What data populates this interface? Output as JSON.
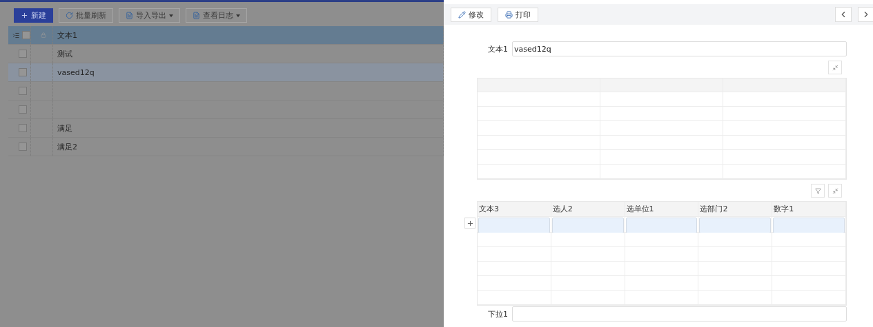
{
  "toolbar": {
    "buttons": [
      {
        "label": "新建",
        "kind": "primary",
        "dropdown": false
      },
      {
        "label": "批量刷新",
        "kind": "default",
        "dropdown": false
      },
      {
        "label": "导入导出",
        "kind": "default",
        "dropdown": true
      },
      {
        "label": "查看日志",
        "kind": "default",
        "dropdown": true
      }
    ]
  },
  "list": {
    "header": "文本1",
    "header_checked": false,
    "rows": [
      {
        "text": "测试",
        "selected": false,
        "checked": false
      },
      {
        "text": "vased12q",
        "selected": true,
        "checked": false
      },
      {
        "selected": false,
        "checked": false
      },
      {
        "selected": false,
        "checked": false
      },
      {
        "text": "满足",
        "selected": false,
        "checked": false
      },
      {
        "text": "满足2",
        "selected": false,
        "checked": false
      }
    ]
  },
  "detail": {
    "actions": [
      {
        "label": "修改"
      },
      {
        "label": "打印"
      }
    ],
    "text_field": {
      "label": "文本1",
      "value": "vased12q"
    },
    "subtable": {
      "columns": [
        "文本3",
        "选人2",
        "选单位1",
        "选部门2",
        "数字1"
      ]
    },
    "dropdown_field": {
      "label": "下拉1"
    }
  }
}
